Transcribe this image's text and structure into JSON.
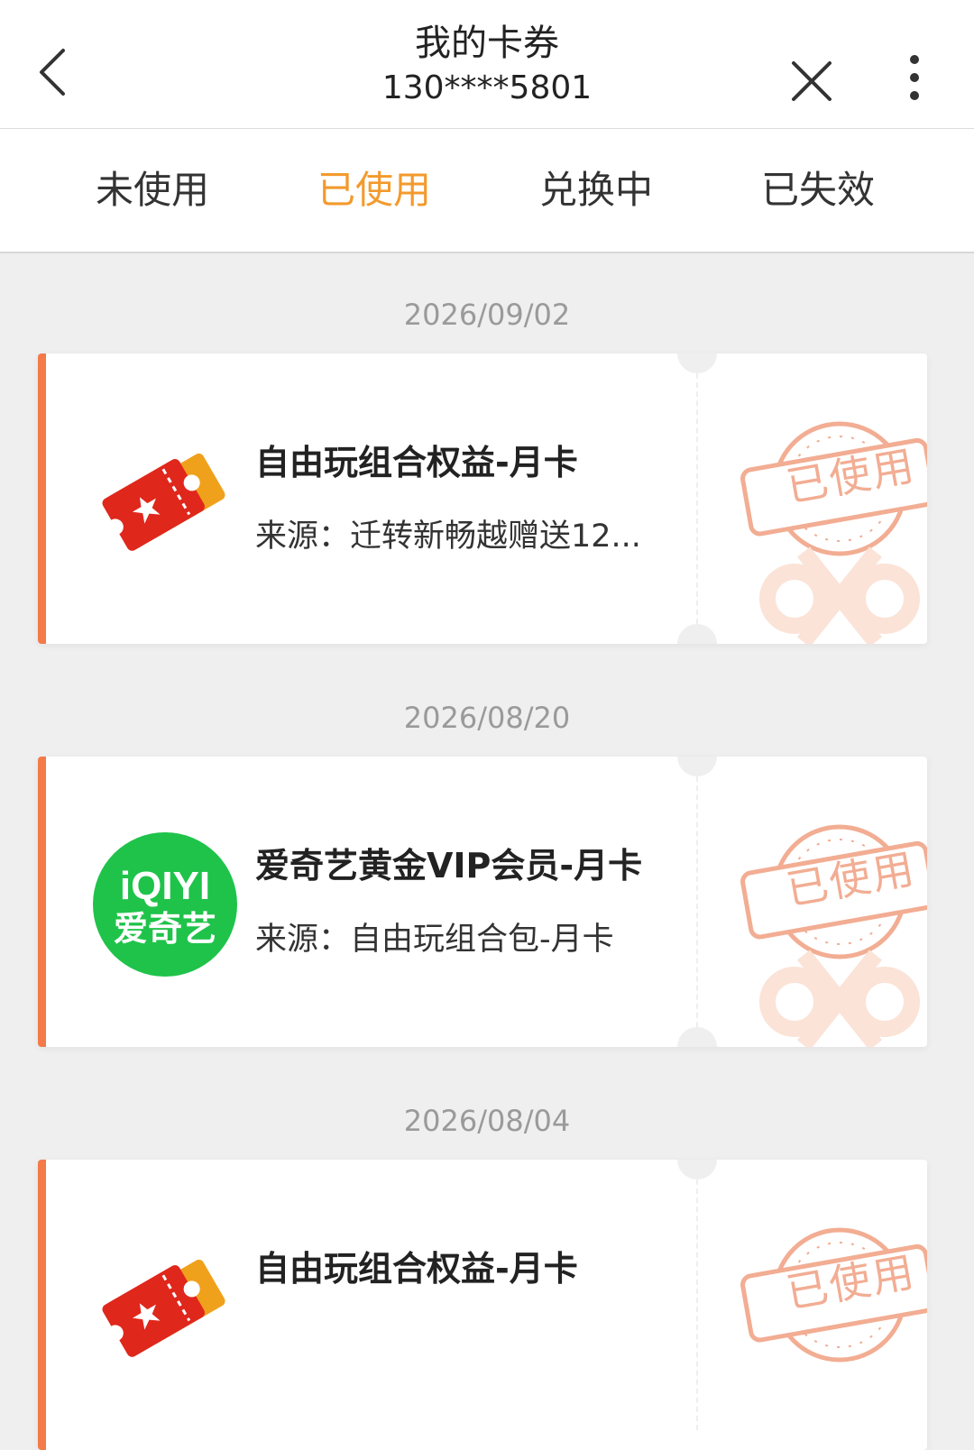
{
  "header": {
    "title": "我的卡券",
    "phone": "130****5801",
    "back_icon": "chevron-left-icon",
    "close_icon": "close-icon",
    "more_icon": "more-vertical-icon"
  },
  "tabs": [
    {
      "label": "未使用"
    },
    {
      "label": "已使用"
    },
    {
      "label": "兑换中"
    },
    {
      "label": "已失效"
    }
  ],
  "active_tab": "已使用",
  "colors": {
    "accent": "#f39a2d",
    "card_edge": "#f47a4a",
    "stamp": "#f2ad93"
  },
  "coupons": [
    {
      "date": "2026/09/02",
      "title": "自由玩组合权益-月卡",
      "source": "来源：迁转新畅越赠送12...",
      "status": "已使用",
      "icon": "ticket-icon"
    },
    {
      "date": "2026/08/20",
      "title": "爱奇艺黄金VIP会员-月卡",
      "source": "来源：自由玩组合包-月卡",
      "status": "已使用",
      "icon": "iqiyi-logo-icon",
      "logo_line1": "iQIYI",
      "logo_line2": "爱奇艺"
    },
    {
      "date": "2026/08/04",
      "title": "自由玩组合权益-月卡",
      "status": "已使用",
      "icon": "ticket-icon"
    }
  ]
}
